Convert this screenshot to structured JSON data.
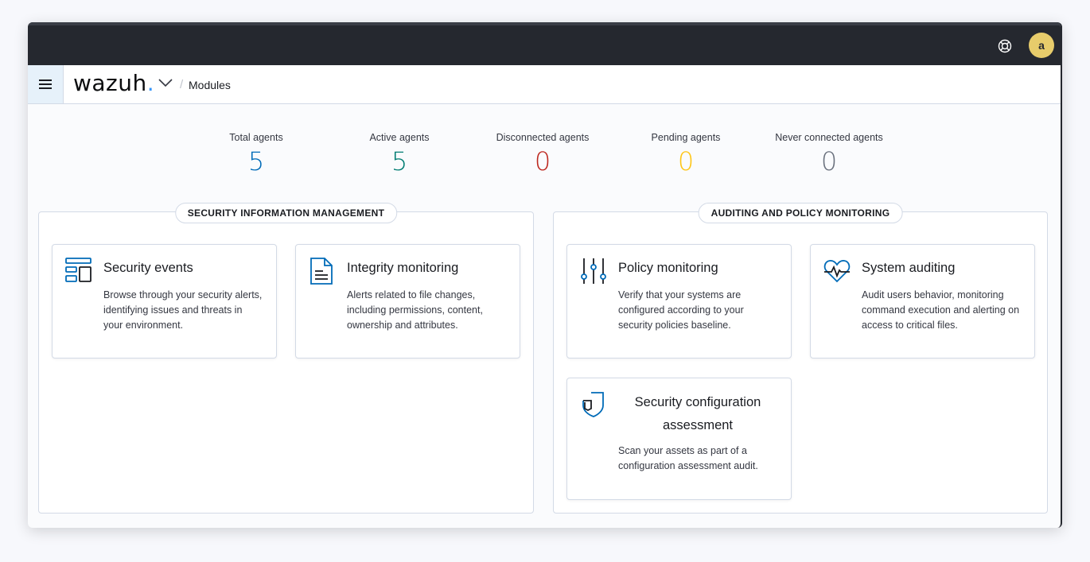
{
  "header": {
    "logo_text": "wazuh",
    "logo_dot": ".",
    "breadcrumb": "Modules",
    "avatar_initial": "a",
    "icons": {
      "menu": "hamburger-icon",
      "help": "lifebuoy-icon",
      "caret": "chevron-down-icon"
    }
  },
  "stats": [
    {
      "label": "Total agents",
      "value": "5",
      "color": "#006bb8"
    },
    {
      "label": "Active agents",
      "value": "5",
      "color": "#017d73"
    },
    {
      "label": "Disconnected agents",
      "value": "0",
      "color": "#bd271e"
    },
    {
      "label": "Pending agents",
      "value": "0",
      "color": "#fec514"
    },
    {
      "label": "Never connected agents",
      "value": "0",
      "color": "#69707d"
    }
  ],
  "sections": {
    "sim": {
      "title": "SECURITY INFORMATION MANAGEMENT",
      "cards": [
        {
          "title": "Security events",
          "desc": "Browse through your security alerts, identifying issues and threats in your environment.",
          "icon": "dashboard-layout-icon"
        },
        {
          "title": "Integrity monitoring",
          "desc": "Alerts related to file changes, including permissions, content, ownership and attributes.",
          "icon": "document-icon"
        }
      ]
    },
    "apm": {
      "title": "AUDITING AND POLICY MONITORING",
      "cards": [
        {
          "title": "Policy monitoring",
          "desc": "Verify that your systems are configured according to your security policies baseline.",
          "icon": "sliders-icon"
        },
        {
          "title": "System auditing",
          "desc": "Audit users behavior, monitoring command execution and alerting on access to critical files.",
          "icon": "heart-pulse-icon"
        },
        {
          "title": "Security configuration assessment",
          "desc": "Scan your assets as part of a configuration assessment audit.",
          "icon": "shield-icon"
        }
      ]
    }
  },
  "colors": {
    "accent": "#006bb8",
    "topbar": "#25282f",
    "avatar": "#e7cc6b"
  }
}
